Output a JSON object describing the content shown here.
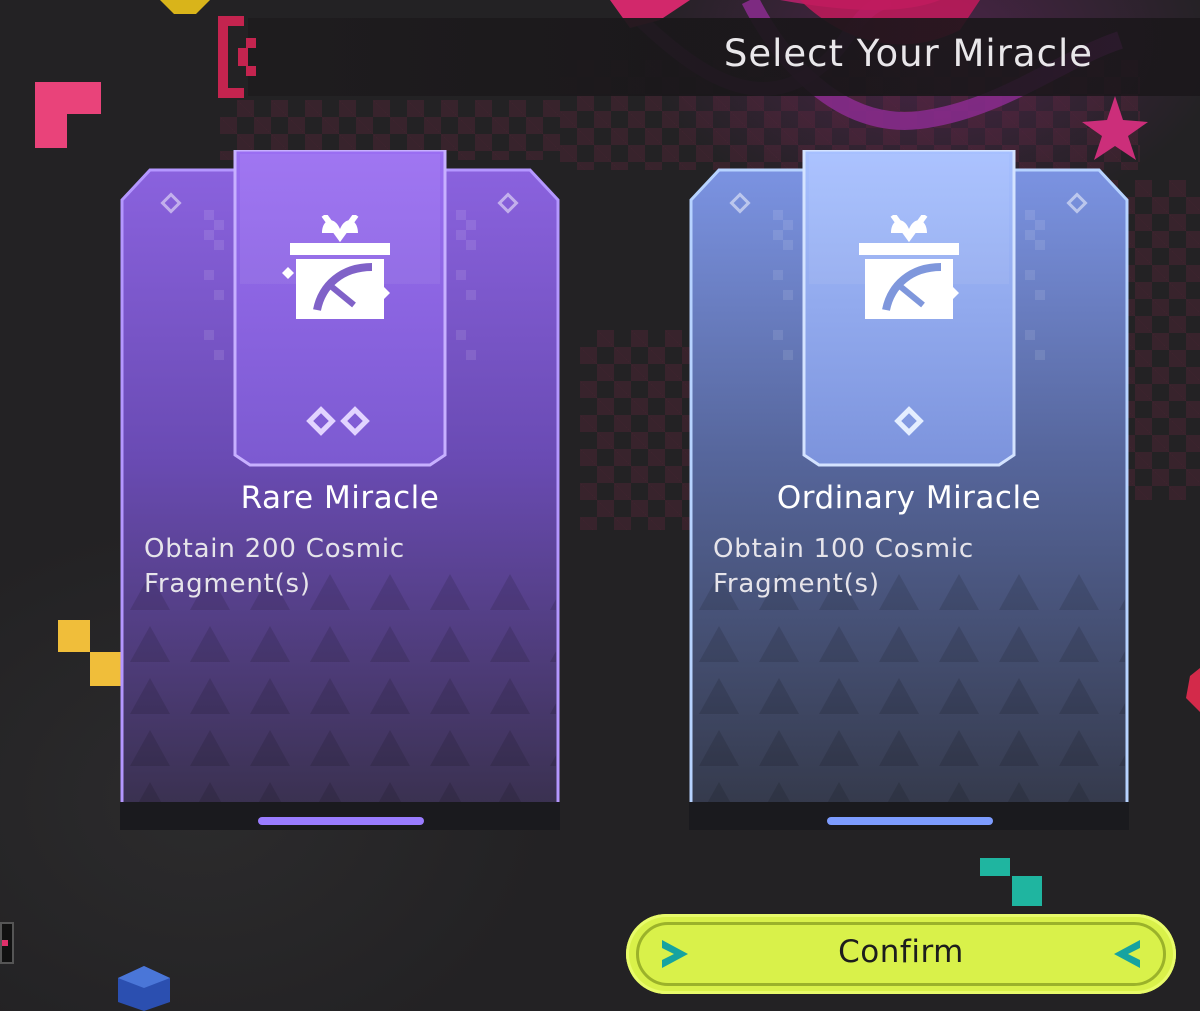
{
  "header": {
    "title": "Select Your Miracle",
    "back_icon": "back-bracket-icon"
  },
  "cards": [
    {
      "title": "Rare Miracle",
      "description": "Obtain 200 Cosmic Fragment(s)",
      "icon": "gift-box-icon",
      "rarity_marks": 2,
      "accent": "#9a6ef2"
    },
    {
      "title": "Ordinary Miracle",
      "description": "Obtain 100 Cosmic Fragment(s)",
      "icon": "gift-box-icon",
      "rarity_marks": 1,
      "accent": "#8aa8f0"
    }
  ],
  "confirm": {
    "label": "Confirm",
    "color": "#d9f14a"
  }
}
